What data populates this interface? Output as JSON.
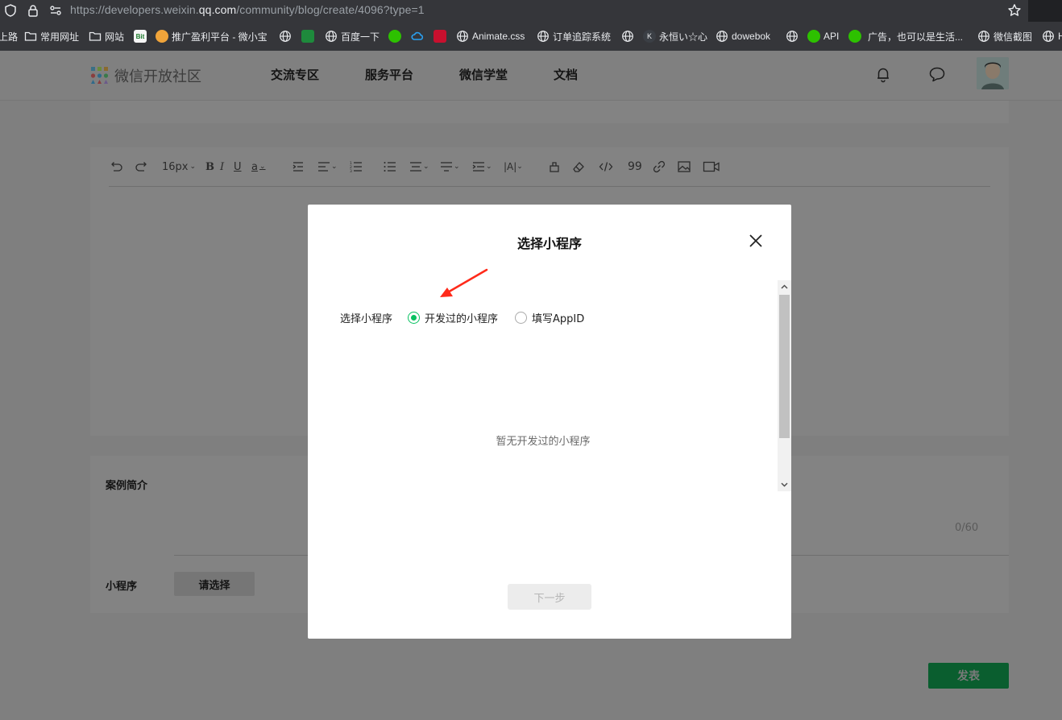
{
  "browser": {
    "url_prefix": "https://developers.weixin.",
    "url_domain": "qq.com",
    "url_path": "/community/blog/create/4096?type=1"
  },
  "bookmarks": [
    {
      "label": "上路",
      "icon": "none"
    },
    {
      "label": "常用网址",
      "icon": "folder-icon"
    },
    {
      "label": "网站",
      "icon": "folder-icon"
    },
    {
      "label": "",
      "icon": "bit-favicon"
    },
    {
      "label": "推广盈利平台 - 微小宝",
      "icon": "emoji-favicon"
    },
    {
      "label": "",
      "icon": "globe-icon"
    },
    {
      "label": "",
      "icon": "green-favicon"
    },
    {
      "label": "百度一下",
      "icon": "globe-icon"
    },
    {
      "label": "",
      "icon": "wechat-favicon"
    },
    {
      "label": "",
      "icon": "cloud-favicon"
    },
    {
      "label": "",
      "icon": "red-favicon"
    },
    {
      "label": "Animate.css",
      "icon": "globe-icon"
    },
    {
      "label": "订单追踪系统",
      "icon": "globe-icon"
    },
    {
      "label": "",
      "icon": "globe-icon"
    },
    {
      "label": "永恒い☆心",
      "icon": "k-favicon"
    },
    {
      "label": "dowebok",
      "icon": "globe-icon"
    },
    {
      "label": "",
      "icon": "globe-icon"
    },
    {
      "label": "API",
      "icon": "wechat-favicon"
    },
    {
      "label": "广告，也可以是生活...",
      "icon": "wechat-favicon"
    },
    {
      "label": "微信截图",
      "icon": "globe-icon"
    },
    {
      "label": "H",
      "icon": "globe-icon"
    }
  ],
  "site": {
    "logo_text": "微信开放社区",
    "nav": [
      "交流专区",
      "服务平台",
      "微信学堂",
      "文档"
    ]
  },
  "editor": {
    "font_size": "16px",
    "quote_label": "99"
  },
  "form": {
    "desc_label": "案例简介",
    "desc_counter": "0/60",
    "miniprogram_label": "小程序",
    "choose_button": "请选择",
    "publish_button": "发表"
  },
  "modal": {
    "title": "选择小程序",
    "field_label": "选择小程序",
    "options": [
      {
        "label": "开发过的小程序",
        "selected": true
      },
      {
        "label": "填写AppID",
        "selected": false
      }
    ],
    "empty_text": "暂无开发过的小程序",
    "next_button": "下一步"
  },
  "colors": {
    "accent": "#07c160",
    "annotation_arrow": "#ff2a1a"
  }
}
